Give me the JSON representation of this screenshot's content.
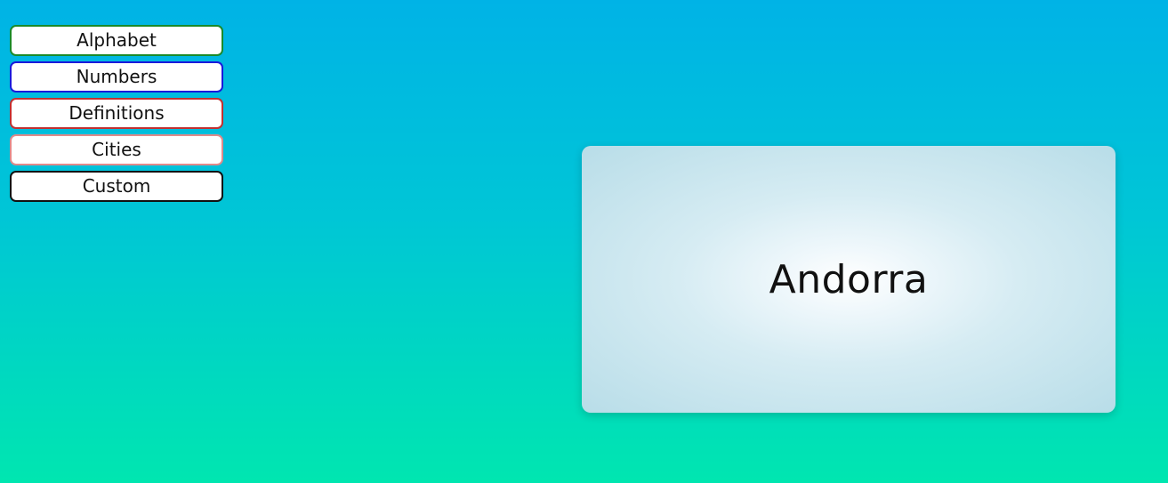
{
  "menu": {
    "items": [
      {
        "label": "Alphabet",
        "border_color": "#1a8a2a"
      },
      {
        "label": "Numbers",
        "border_color": "#1a1adb"
      },
      {
        "label": "Definitions",
        "border_color": "#c23030"
      },
      {
        "label": "Cities",
        "border_color": "#e08a8a"
      },
      {
        "label": "Custom",
        "border_color": "#111111"
      }
    ]
  },
  "flashcard": {
    "word": "Andorra"
  },
  "colors": {
    "background_top": "#00b3e6",
    "background_bottom": "#00e6b0"
  }
}
